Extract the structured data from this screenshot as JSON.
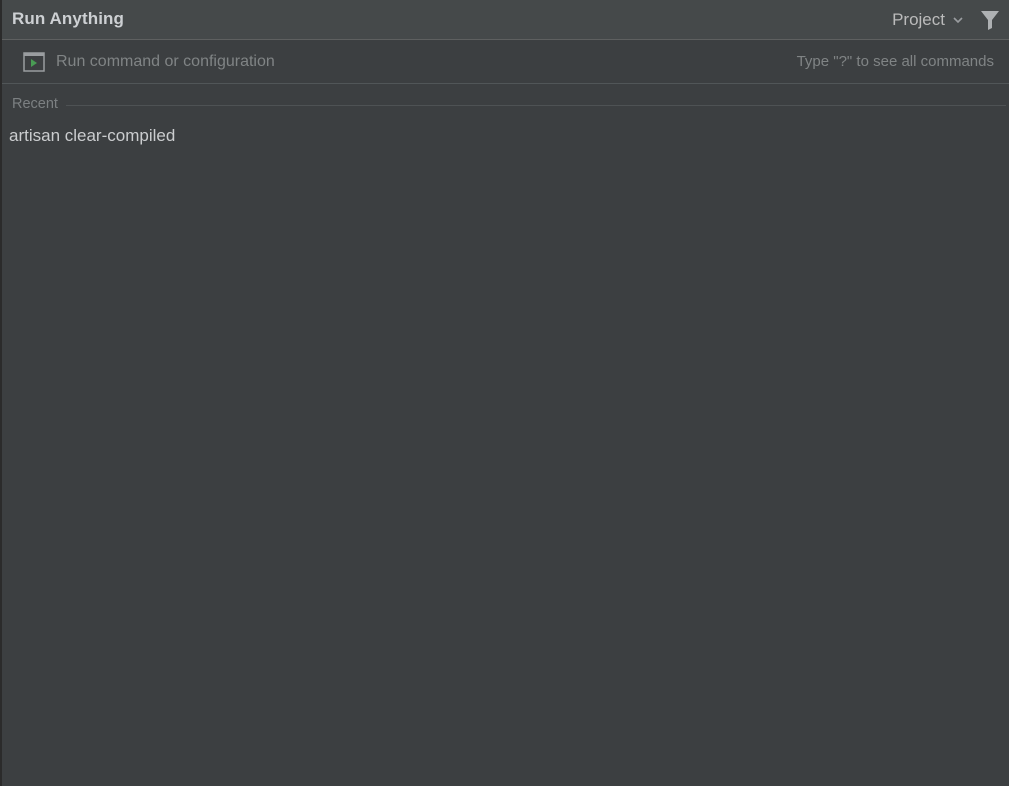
{
  "window": {
    "title": "Run Anything"
  },
  "header": {
    "scope_label": "Project",
    "scope_icon": "chevron-down-icon",
    "filter_icon": "filter-icon"
  },
  "search": {
    "value": "",
    "placeholder": "Run command or configuration",
    "hint": "Type \"?\" to see all commands",
    "icon": "run-configuration-icon"
  },
  "sections": [
    {
      "label": "Recent",
      "items": [
        {
          "label": "artisan clear-compiled"
        }
      ]
    }
  ],
  "colors": {
    "background": "#3c3f41",
    "header": "#45494a",
    "accent_run": "#499c54"
  }
}
